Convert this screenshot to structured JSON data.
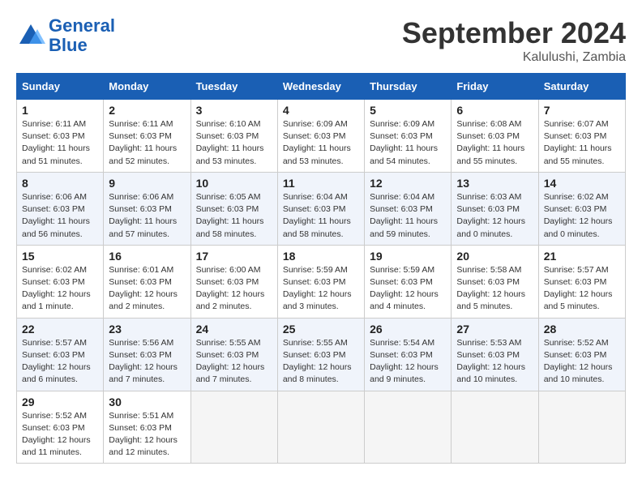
{
  "header": {
    "logo_line1": "General",
    "logo_line2": "Blue",
    "month": "September 2024",
    "location": "Kalulushi, Zambia"
  },
  "weekdays": [
    "Sunday",
    "Monday",
    "Tuesday",
    "Wednesday",
    "Thursday",
    "Friday",
    "Saturday"
  ],
  "weeks": [
    [
      {
        "day": "1",
        "info": "Sunrise: 6:11 AM\nSunset: 6:03 PM\nDaylight: 11 hours\nand 51 minutes."
      },
      {
        "day": "2",
        "info": "Sunrise: 6:11 AM\nSunset: 6:03 PM\nDaylight: 11 hours\nand 52 minutes."
      },
      {
        "day": "3",
        "info": "Sunrise: 6:10 AM\nSunset: 6:03 PM\nDaylight: 11 hours\nand 53 minutes."
      },
      {
        "day": "4",
        "info": "Sunrise: 6:09 AM\nSunset: 6:03 PM\nDaylight: 11 hours\nand 53 minutes."
      },
      {
        "day": "5",
        "info": "Sunrise: 6:09 AM\nSunset: 6:03 PM\nDaylight: 11 hours\nand 54 minutes."
      },
      {
        "day": "6",
        "info": "Sunrise: 6:08 AM\nSunset: 6:03 PM\nDaylight: 11 hours\nand 55 minutes."
      },
      {
        "day": "7",
        "info": "Sunrise: 6:07 AM\nSunset: 6:03 PM\nDaylight: 11 hours\nand 55 minutes."
      }
    ],
    [
      {
        "day": "8",
        "info": "Sunrise: 6:06 AM\nSunset: 6:03 PM\nDaylight: 11 hours\nand 56 minutes."
      },
      {
        "day": "9",
        "info": "Sunrise: 6:06 AM\nSunset: 6:03 PM\nDaylight: 11 hours\nand 57 minutes."
      },
      {
        "day": "10",
        "info": "Sunrise: 6:05 AM\nSunset: 6:03 PM\nDaylight: 11 hours\nand 58 minutes."
      },
      {
        "day": "11",
        "info": "Sunrise: 6:04 AM\nSunset: 6:03 PM\nDaylight: 11 hours\nand 58 minutes."
      },
      {
        "day": "12",
        "info": "Sunrise: 6:04 AM\nSunset: 6:03 PM\nDaylight: 11 hours\nand 59 minutes."
      },
      {
        "day": "13",
        "info": "Sunrise: 6:03 AM\nSunset: 6:03 PM\nDaylight: 12 hours\nand 0 minutes."
      },
      {
        "day": "14",
        "info": "Sunrise: 6:02 AM\nSunset: 6:03 PM\nDaylight: 12 hours\nand 0 minutes."
      }
    ],
    [
      {
        "day": "15",
        "info": "Sunrise: 6:02 AM\nSunset: 6:03 PM\nDaylight: 12 hours\nand 1 minute."
      },
      {
        "day": "16",
        "info": "Sunrise: 6:01 AM\nSunset: 6:03 PM\nDaylight: 12 hours\nand 2 minutes."
      },
      {
        "day": "17",
        "info": "Sunrise: 6:00 AM\nSunset: 6:03 PM\nDaylight: 12 hours\nand 2 minutes."
      },
      {
        "day": "18",
        "info": "Sunrise: 5:59 AM\nSunset: 6:03 PM\nDaylight: 12 hours\nand 3 minutes."
      },
      {
        "day": "19",
        "info": "Sunrise: 5:59 AM\nSunset: 6:03 PM\nDaylight: 12 hours\nand 4 minutes."
      },
      {
        "day": "20",
        "info": "Sunrise: 5:58 AM\nSunset: 6:03 PM\nDaylight: 12 hours\nand 5 minutes."
      },
      {
        "day": "21",
        "info": "Sunrise: 5:57 AM\nSunset: 6:03 PM\nDaylight: 12 hours\nand 5 minutes."
      }
    ],
    [
      {
        "day": "22",
        "info": "Sunrise: 5:57 AM\nSunset: 6:03 PM\nDaylight: 12 hours\nand 6 minutes."
      },
      {
        "day": "23",
        "info": "Sunrise: 5:56 AM\nSunset: 6:03 PM\nDaylight: 12 hours\nand 7 minutes."
      },
      {
        "day": "24",
        "info": "Sunrise: 5:55 AM\nSunset: 6:03 PM\nDaylight: 12 hours\nand 7 minutes."
      },
      {
        "day": "25",
        "info": "Sunrise: 5:55 AM\nSunset: 6:03 PM\nDaylight: 12 hours\nand 8 minutes."
      },
      {
        "day": "26",
        "info": "Sunrise: 5:54 AM\nSunset: 6:03 PM\nDaylight: 12 hours\nand 9 minutes."
      },
      {
        "day": "27",
        "info": "Sunrise: 5:53 AM\nSunset: 6:03 PM\nDaylight: 12 hours\nand 10 minutes."
      },
      {
        "day": "28",
        "info": "Sunrise: 5:52 AM\nSunset: 6:03 PM\nDaylight: 12 hours\nand 10 minutes."
      }
    ],
    [
      {
        "day": "29",
        "info": "Sunrise: 5:52 AM\nSunset: 6:03 PM\nDaylight: 12 hours\nand 11 minutes."
      },
      {
        "day": "30",
        "info": "Sunrise: 5:51 AM\nSunset: 6:03 PM\nDaylight: 12 hours\nand 12 minutes."
      },
      {
        "day": "",
        "info": ""
      },
      {
        "day": "",
        "info": ""
      },
      {
        "day": "",
        "info": ""
      },
      {
        "day": "",
        "info": ""
      },
      {
        "day": "",
        "info": ""
      }
    ]
  ]
}
